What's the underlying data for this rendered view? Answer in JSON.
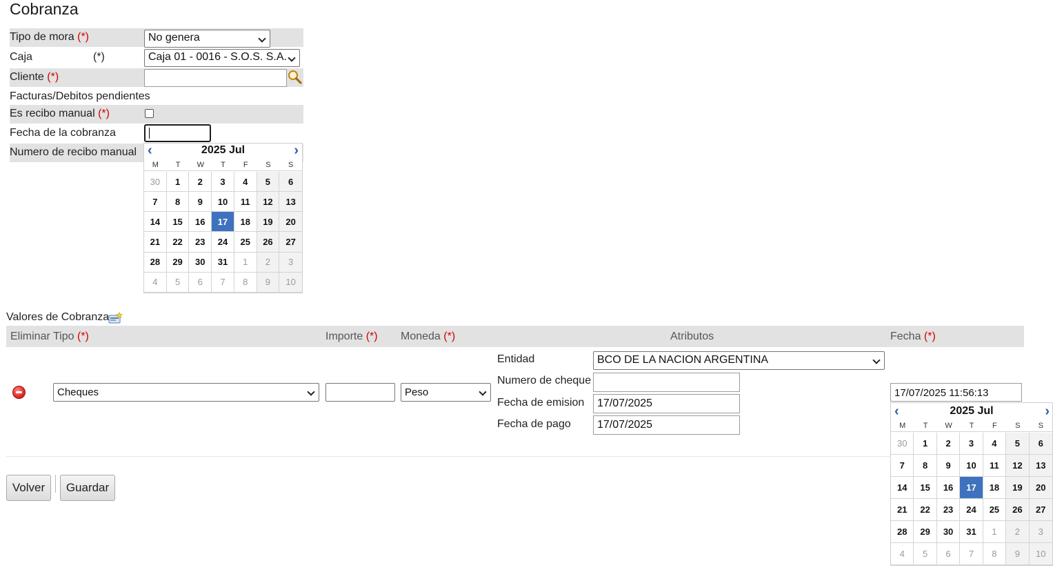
{
  "page": {
    "title": "Cobranza"
  },
  "form": {
    "tipo_mora": {
      "label": "Tipo de mora",
      "required": "(*)",
      "value": "No genera"
    },
    "caja": {
      "label": "Caja",
      "required": "(*)",
      "value": "Caja 01 - 0016 - S.O.S. S.A."
    },
    "cliente": {
      "label": "Cliente",
      "required": "(*)",
      "value": ""
    },
    "facturas": {
      "label": "Facturas/Debitos pendientes"
    },
    "recibo_manual": {
      "label": "Es recibo manual",
      "required": "(*)",
      "checked": false
    },
    "fecha_cobranza": {
      "label": "Fecha de la cobranza",
      "value": ""
    },
    "numero_recibo": {
      "label": "Numero de recibo manual"
    }
  },
  "calendar": {
    "title": "2025 Jul",
    "prev": "‹",
    "next": "›",
    "weekdays": [
      "M",
      "T",
      "W",
      "T",
      "F",
      "S",
      "S"
    ],
    "selected_day": "17",
    "weeks": [
      [
        "30",
        "1",
        "2",
        "3",
        "4",
        "5",
        "6"
      ],
      [
        "7",
        "8",
        "9",
        "10",
        "11",
        "12",
        "13"
      ],
      [
        "14",
        "15",
        "16",
        "17",
        "18",
        "19",
        "20"
      ],
      [
        "21",
        "22",
        "23",
        "24",
        "25",
        "26",
        "27"
      ],
      [
        "28",
        "29",
        "30",
        "31",
        "1",
        "2",
        "3"
      ],
      [
        "4",
        "5",
        "6",
        "7",
        "8",
        "9",
        "10"
      ]
    ]
  },
  "valores": {
    "title": "Valores de Cobranza",
    "headers": {
      "eliminar": "Eliminar",
      "tipo": "Tipo",
      "importe": "Importe",
      "moneda": "Moneda",
      "atributos": "Atributos",
      "fecha": "Fecha",
      "required": "(*)"
    },
    "row": {
      "tipo": "Cheques",
      "importe": "",
      "moneda": "Peso",
      "fecha": "17/07/2025 11:56:13",
      "attributes": {
        "entidad_label": "Entidad",
        "entidad_value": "BCO DE LA NACION ARGENTINA",
        "numero_cheque_label": "Numero de cheque",
        "numero_cheque_value": "",
        "fecha_emision_label": "Fecha de emision",
        "fecha_emision_value": "17/07/2025",
        "fecha_pago_label": "Fecha de pago",
        "fecha_pago_value": "17/07/2025"
      }
    }
  },
  "buttons": {
    "volver": "Volver",
    "guardar": "Guardar"
  },
  "colors": {
    "required": "#d40000",
    "row_shade": "#e2e2e2",
    "selected_day": "#3e72bf",
    "nav_arrow": "#2b5ba8"
  }
}
